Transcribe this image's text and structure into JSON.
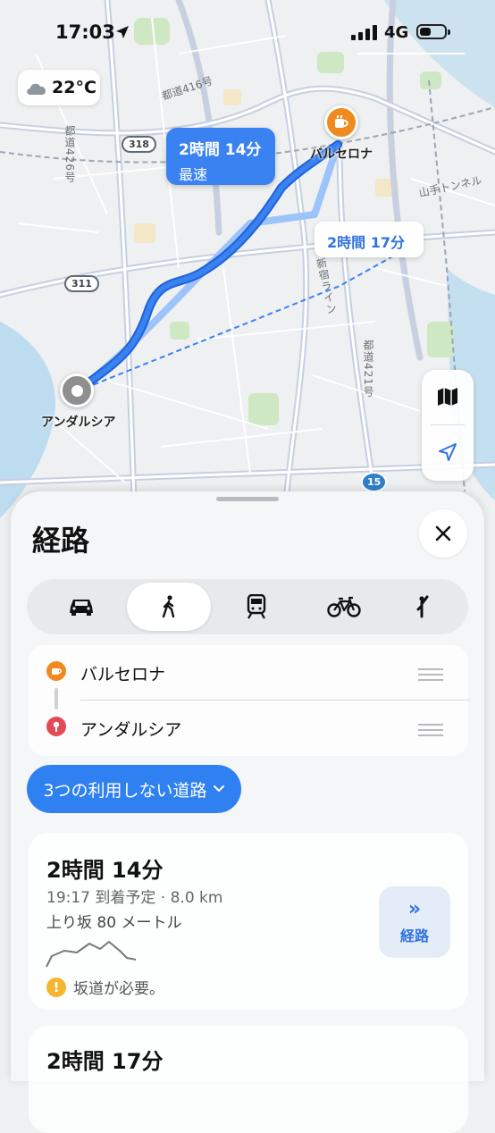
{
  "status_bar": {
    "time": "17:03",
    "network": "4G",
    "battery_level": 0.45
  },
  "weather": {
    "temperature": "22°C",
    "icon": "cloud-icon"
  },
  "map": {
    "labels": {
      "road_416": "都道416号",
      "road_426": "都道426号",
      "road_421": "都道421号",
      "tunnel": "山手トンネル",
      "shinjuku_line": "新宿ライン",
      "shield_318": "318",
      "shield_311": "311",
      "shield_15": "15"
    },
    "origin": "アンダルシア",
    "destination": "バルセロナ",
    "callout_fastest": {
      "time": "2時間 14分",
      "tag": "最速"
    },
    "callout_alt": {
      "time": "2時間 17分"
    }
  },
  "sheet": {
    "title": "経路",
    "modes": [
      "車",
      "徒歩",
      "交通機関",
      "自転車",
      "配車サービス"
    ],
    "active_mode": "徒歩",
    "waypoints": [
      {
        "label": "バルセロナ",
        "icon": "cafe-icon"
      },
      {
        "label": "アンダルシア",
        "icon": "pin-icon"
      }
    ],
    "avoid_label": "3つの利用しない道路",
    "routes": [
      {
        "duration": "2時間 14分",
        "meta": "19:17 到着予定 · 8.0 km",
        "climb": "上り坂 80 メートル",
        "warning": "坂道が必要。",
        "go_label": "経路"
      },
      {
        "duration": "2時間 17分"
      }
    ]
  },
  "colors": {
    "accent": "#2f80f0",
    "route": "#3a82f2",
    "destination_pin": "#f08a1e",
    "warning": "#f5b52e"
  }
}
